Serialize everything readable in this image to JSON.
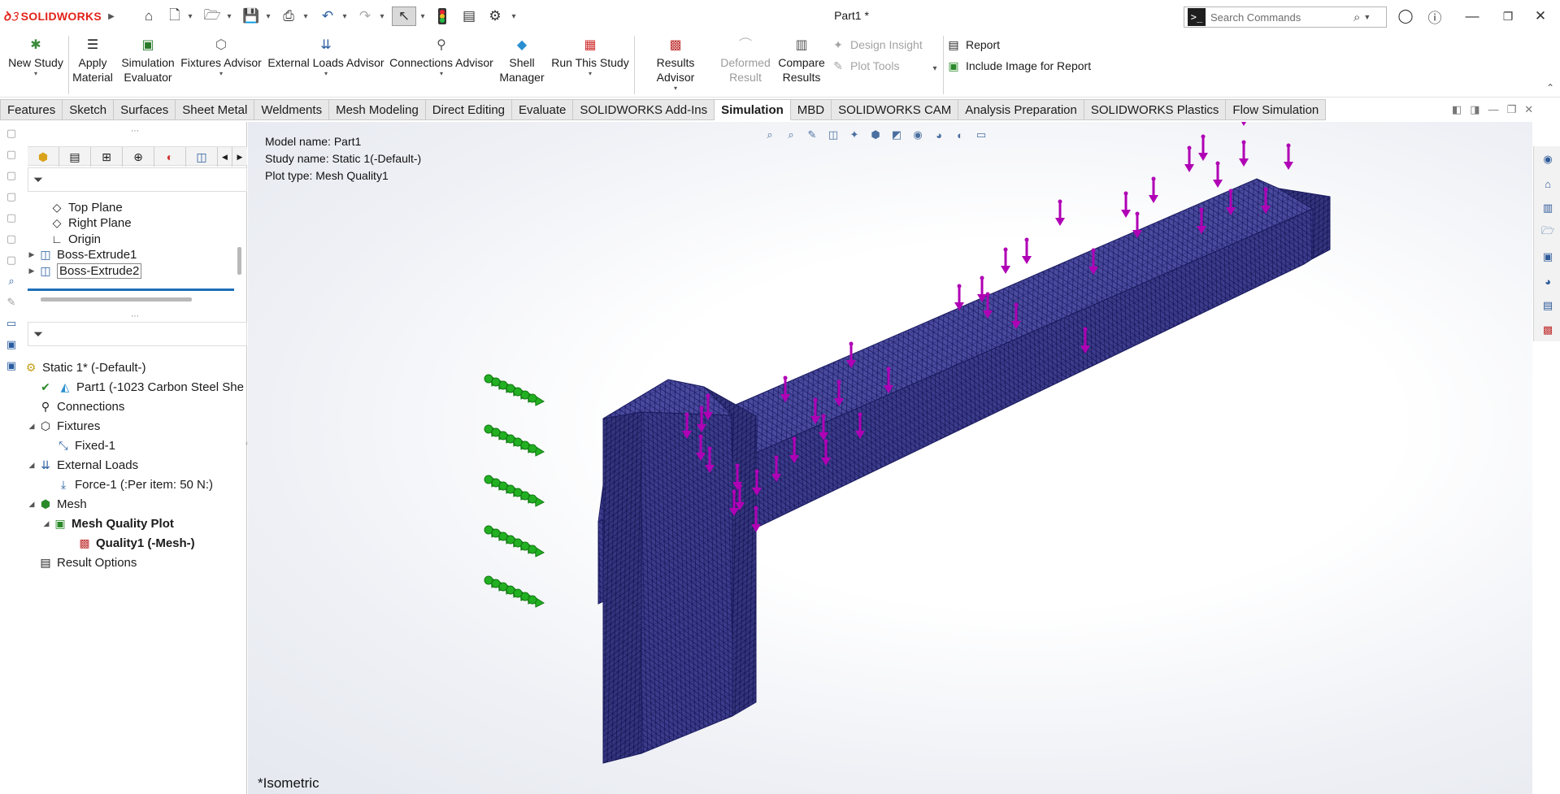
{
  "app": {
    "brand": "SOLIDWORKS",
    "document_title": "Part1 *"
  },
  "search": {
    "placeholder": "Search Commands",
    "prompt_icon": ">_"
  },
  "ribbon": {
    "new_study": "New Study",
    "apply_material_1": "Apply",
    "apply_material_2": "Material",
    "sim_eval_1": "Simulation",
    "sim_eval_2": "Evaluator",
    "fixtures_advisor": "Fixtures Advisor",
    "external_loads_advisor": "External Loads Advisor",
    "connections_advisor": "Connections Advisor",
    "shell_manager_1": "Shell",
    "shell_manager_2": "Manager",
    "run_this_study": "Run This Study",
    "results_advisor": "Results Advisor",
    "deformed_result_1": "Deformed",
    "deformed_result_2": "Result",
    "compare_results_1": "Compare",
    "compare_results_2": "Results",
    "design_insight": "Design Insight",
    "plot_tools": "Plot Tools",
    "report": "Report",
    "include_image": "Include Image for Report"
  },
  "tabs": [
    "Features",
    "Sketch",
    "Surfaces",
    "Sheet Metal",
    "Weldments",
    "Mesh Modeling",
    "Direct Editing",
    "Evaluate",
    "SOLIDWORKS Add-Ins",
    "Simulation",
    "MBD",
    "SOLIDWORKS CAM",
    "Analysis Preparation",
    "SOLIDWORKS Plastics",
    "Flow Simulation"
  ],
  "active_tab": "Simulation",
  "feature_tree": {
    "items": [
      "Top Plane",
      "Right Plane",
      "Origin",
      "Boss-Extrude1",
      "Boss-Extrude2"
    ]
  },
  "study_tree": {
    "study": "Static 1* (-Default-)",
    "part": "Part1 (-1023 Carbon Steel She",
    "connections": "Connections",
    "fixtures": "Fixtures",
    "fixed": "Fixed-1",
    "external_loads": "External Loads",
    "force": "Force-1 (:Per item: 50 N:)",
    "mesh": "Mesh",
    "mesh_quality_plot": "Mesh Quality Plot",
    "quality1": "Quality1 (-Mesh-)",
    "result_options": "Result Options"
  },
  "graphics": {
    "model_name": "Model name: Part1",
    "study_name": "Study name: Static 1(-Default-)",
    "plot_type": "Plot type: Mesh Quality1",
    "view_label": "*Isometric",
    "mesh_color": "#3a3a8f",
    "load_color": "#b000b5",
    "fixture_color": "#22b022"
  }
}
